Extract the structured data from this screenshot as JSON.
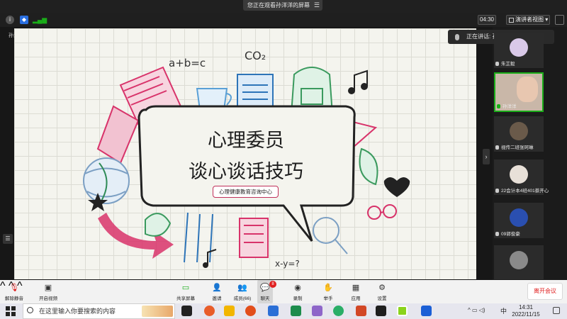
{
  "window": {
    "share_banner": "您正在观看孙洋洋的屏幕",
    "timer": "04:30",
    "view_mode": "演讲者视图",
    "sharer_tag": "孙洋洋"
  },
  "slide": {
    "title_line1": "心理委员",
    "title_line2": "谈心谈话技巧",
    "subtitle": "心理健康教育咨询中心"
  },
  "sidebar": {
    "speaking_label": "正在讲话: 孙洋洋;",
    "participants": [
      {
        "name": "朱芷毅"
      },
      {
        "name": "孙洋洋"
      },
      {
        "name": "视传二班张珂琳"
      },
      {
        "name": "22会计本4班401蔡开心"
      },
      {
        "name": "09郭俊豪"
      },
      {
        "name": ""
      }
    ]
  },
  "toolbar": {
    "unmute": "解除静音",
    "start_video": "开启视频",
    "share_screen": "共享屏幕",
    "invite": "邀请",
    "members": "成员(66)",
    "chat": "聊天",
    "chat_badge": "8",
    "record": "录制",
    "raise_hand": "举手",
    "apps": "应用",
    "settings": "设置",
    "leave": "离开会议"
  },
  "taskbar": {
    "search_placeholder": "在这里输入你要搜索的内容",
    "ime": "中",
    "time": "14:31",
    "date": "2022/11/15"
  },
  "colors": {
    "accent_red": "#e02020",
    "subtitle_border": "#c0305a",
    "active_green": "#1aad19"
  }
}
